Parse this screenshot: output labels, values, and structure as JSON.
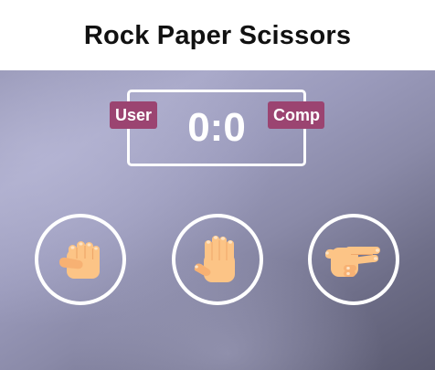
{
  "header": {
    "title": "Rock Paper Scissors"
  },
  "scoreboard": {
    "user_label": "User",
    "comp_label": "Comp",
    "user_score": 0,
    "comp_score": 0,
    "score_text": "0:0"
  },
  "choices": [
    {
      "id": "rock",
      "icon": "rock-hand-icon"
    },
    {
      "id": "paper",
      "icon": "paper-hand-icon"
    },
    {
      "id": "scissors",
      "icon": "scissors-hand-icon"
    }
  ],
  "colors": {
    "badge": "#9b4471",
    "skin": "#fcc486",
    "skin_shade": "#f0a86a",
    "nail": "#fde3c4",
    "outline": "#ffffff"
  }
}
